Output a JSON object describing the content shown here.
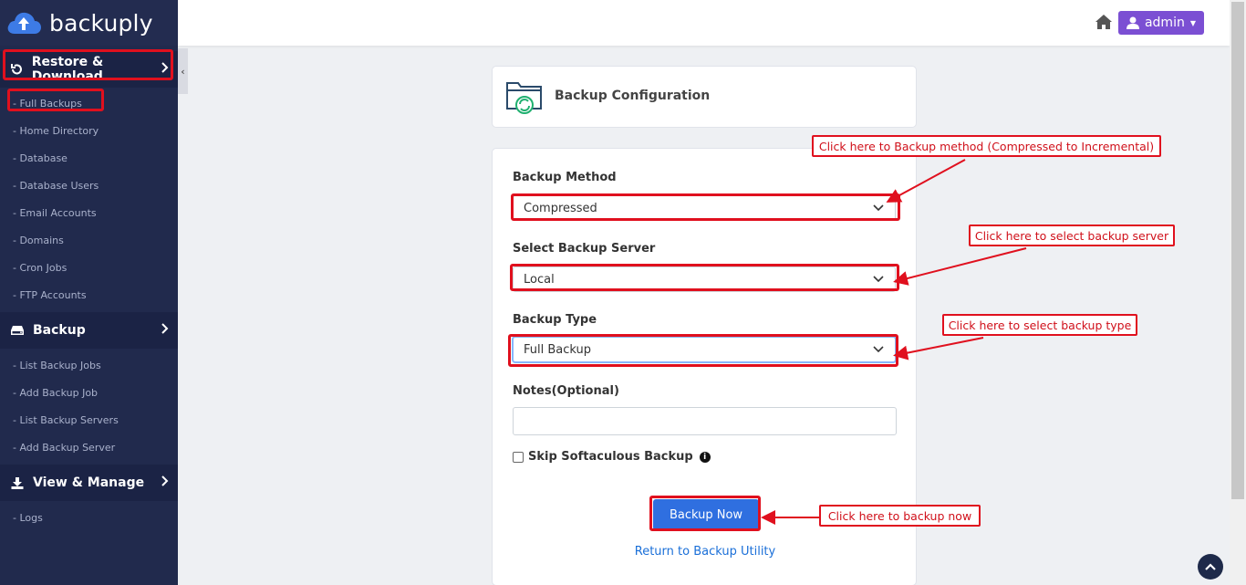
{
  "brand": {
    "name": "backuply"
  },
  "sidebar": {
    "sections": [
      {
        "label": "Restore & Download",
        "icon": "restore-icon",
        "items": [
          "- Full Backups",
          "- Home Directory",
          "- Database",
          "- Database Users",
          "- Email Accounts",
          "- Domains",
          "- Cron Jobs",
          "- FTP Accounts"
        ]
      },
      {
        "label": "Backup",
        "icon": "drive-icon",
        "items": [
          "- List Backup Jobs",
          "- Add Backup Job",
          "- List Backup Servers",
          "- Add Backup Server"
        ]
      },
      {
        "label": "View & Manage",
        "icon": "download-icon",
        "items": [
          "- Logs"
        ]
      }
    ]
  },
  "header": {
    "admin_label": "admin"
  },
  "config": {
    "title": "Backup Configuration"
  },
  "form": {
    "method_label": "Backup Method",
    "method_value": "Compressed",
    "server_label": "Select Backup Server",
    "server_value": "Local",
    "type_label": "Backup Type",
    "type_value": "Full Backup",
    "notes_label": "Notes(Optional)",
    "skip_label": "Skip Softaculous Backup",
    "backup_button": "Backup Now",
    "return_link": "Return to Backup Utility"
  },
  "annotations": {
    "method": "Click here to Backup method (Compressed to Incremental)",
    "server": "Click here to select backup server",
    "type": "Click here to select backup type",
    "backup": "Click here to backup now"
  },
  "colors": {
    "sidebar": "#212a4d",
    "accent": "#2f6fe0",
    "admin": "#7b4fd3",
    "annotation": "#e0101e"
  }
}
